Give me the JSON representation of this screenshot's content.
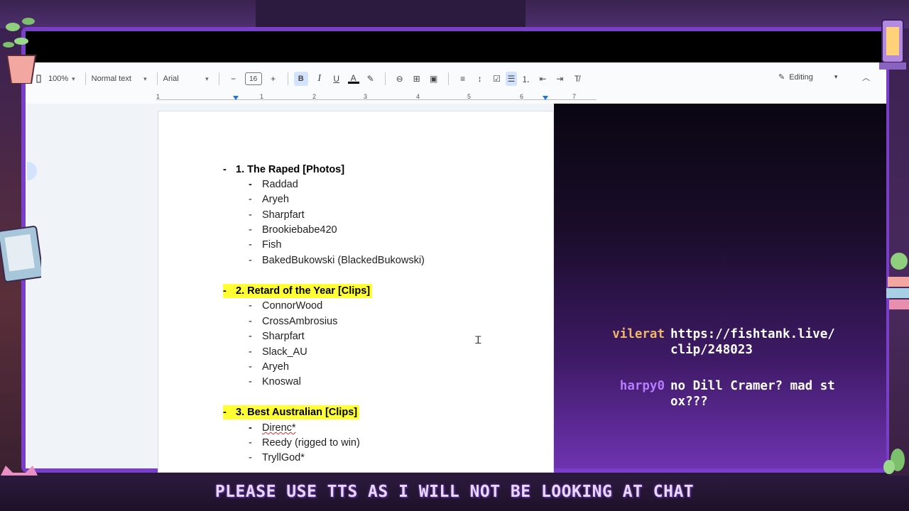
{
  "toolbar": {
    "zoom": "100%",
    "style": "Normal text",
    "font": "Arial",
    "font_size": "16",
    "mode": "Editing"
  },
  "ruler": {
    "numbers": [
      "1",
      "1",
      "2",
      "3",
      "4",
      "5",
      "6",
      "7"
    ]
  },
  "doc": {
    "sections": [
      {
        "heading": "1. The Raped [Photos]",
        "highlighted": false,
        "items": [
          "Raddad",
          "Aryeh",
          "Sharpfart",
          "Brookiebabe420",
          "Fish",
          "BakedBukowski (BlackedBukowski)"
        ]
      },
      {
        "heading": "2. Retard of the Year [Clips]",
        "highlighted": true,
        "items": [
          "ConnorWood",
          "CrossAmbrosius",
          "Sharpfart",
          "Slack_AU",
          "Aryeh",
          "Knoswal"
        ]
      },
      {
        "heading": "3. Best Australian [Clips]",
        "highlighted": true,
        "items": [
          "Direnc*",
          "Reedy (rigged to win)",
          "TryllGod*"
        ]
      }
    ],
    "dash": "-"
  },
  "chat": [
    {
      "user": "vilerat",
      "user_color": "#f0b56a",
      "message": "https://fishtank.live/clip/248023"
    },
    {
      "user": "harpy0",
      "user_color": "#b77cff",
      "message": "no Dill Cramer? mad stox???"
    }
  ],
  "banner": "PLEASE USE TTS AS I WILL NOT BE LOOKING AT CHAT",
  "colors": {
    "frame": "#7a3fc8",
    "highlight": "#ffff33",
    "accent": "#1a73e8"
  }
}
